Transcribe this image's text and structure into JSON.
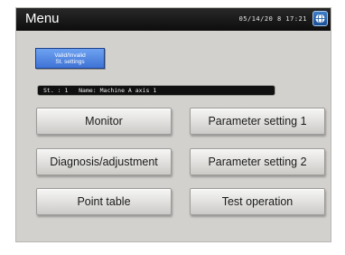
{
  "window": {
    "title": "Menu",
    "clock": "05/14/20 8 17:21"
  },
  "icons": {
    "top_right": "globe-icon"
  },
  "settings_button": {
    "line1": "Valid/Invalid",
    "line2": "St. settings"
  },
  "status": {
    "text": "St. : 1   Name: Machine A axis 1"
  },
  "buttons": {
    "monitor": "Monitor",
    "parameter_setting_1": "Parameter setting 1",
    "diagnosis": "Diagnosis/adjustment",
    "parameter_setting_2": "Parameter setting 2",
    "point_table": "Point table",
    "test_operation": "Test operation"
  },
  "colors": {
    "titlebar": "#111111",
    "panel": "#d3d1ce",
    "accent": "#4a7fe0"
  }
}
